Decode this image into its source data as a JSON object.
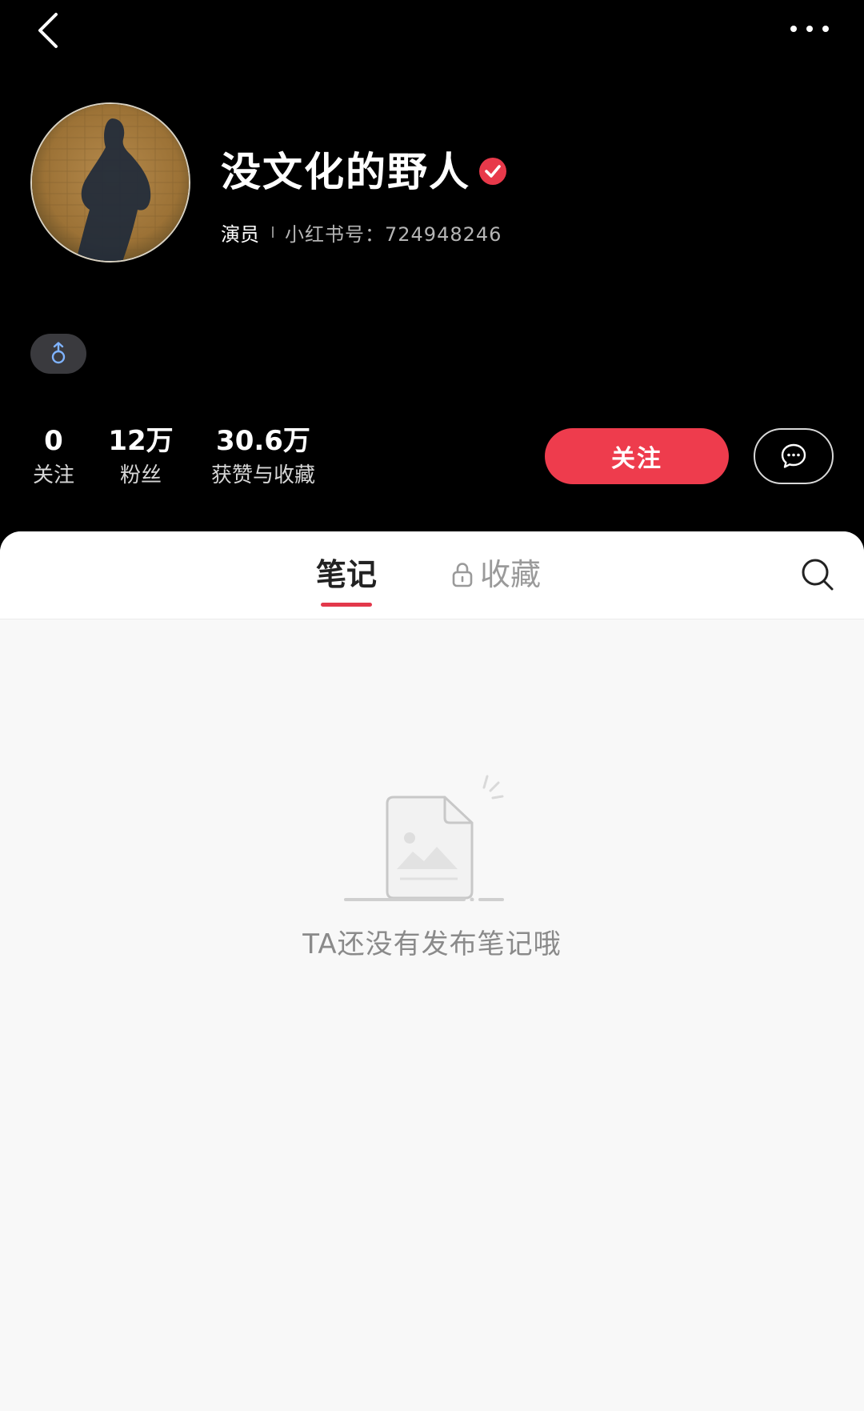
{
  "profile": {
    "username": "没文化的野人",
    "occupation": "演员",
    "red_id": "小红书号：724948246",
    "gender_icon": "male-symbol-icon"
  },
  "stats": {
    "following_count": "0",
    "following_label": "关注",
    "fans_count": "12万",
    "fans_label": "粉丝",
    "likes_count": "30.6万",
    "likes_label": "获赞与收藏"
  },
  "actions": {
    "follow_label": "关注"
  },
  "tabs": {
    "notes": "笔记",
    "collect": "收藏",
    "active": "notes"
  },
  "empty_state": {
    "message": "TA还没有发布笔记哦"
  },
  "colors": {
    "accent": "#ee3c4d",
    "verified": "#e8394a",
    "header_bg": "#000000",
    "content_bg": "#f8f8f8"
  }
}
